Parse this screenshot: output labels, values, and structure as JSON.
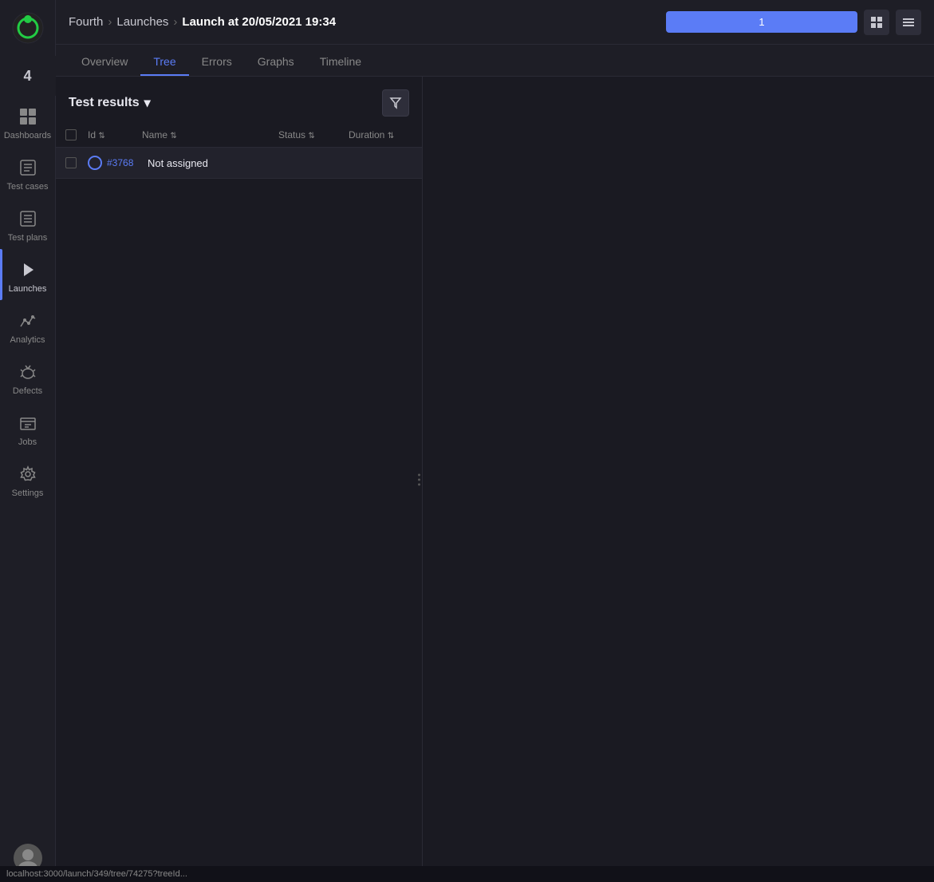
{
  "app": {
    "logo_alt": "App logo"
  },
  "sidebar": {
    "badge": "4",
    "items": [
      {
        "id": "dashboards",
        "label": "Dashboards",
        "active": false
      },
      {
        "id": "test-cases",
        "label": "Test cases",
        "active": false
      },
      {
        "id": "test-plans",
        "label": "Test plans",
        "active": false
      },
      {
        "id": "launches",
        "label": "Launches",
        "active": true
      },
      {
        "id": "analytics",
        "label": "Analytics",
        "active": false
      },
      {
        "id": "defects",
        "label": "Defects",
        "active": false
      },
      {
        "id": "jobs",
        "label": "Jobs",
        "active": false
      },
      {
        "id": "settings",
        "label": "Settings",
        "active": false
      }
    ]
  },
  "header": {
    "breadcrumb": {
      "project": "Fourth",
      "section": "Launches",
      "page": "Launch at 20/05/2021 19:34"
    },
    "search_value": "1",
    "search_placeholder": "1",
    "btn_grid_label": "Grid view",
    "btn_menu_label": "Menu"
  },
  "tabs": [
    {
      "id": "overview",
      "label": "Overview"
    },
    {
      "id": "tree",
      "label": "Tree",
      "active": true
    },
    {
      "id": "errors",
      "label": "Errors"
    },
    {
      "id": "graphs",
      "label": "Graphs"
    },
    {
      "id": "timeline",
      "label": "Timeline"
    }
  ],
  "panel": {
    "title": "Test results",
    "chevron": "▾",
    "filter_icon": "filter",
    "table": {
      "columns": [
        {
          "id": "id",
          "label": "Id",
          "sort": true
        },
        {
          "id": "name",
          "label": "Name",
          "sort": true
        },
        {
          "id": "status",
          "label": "Status",
          "sort": true
        },
        {
          "id": "duration",
          "label": "Duration",
          "sort": true
        }
      ],
      "rows": [
        {
          "id": "#3768",
          "name": "Not assigned",
          "status": "in-progress",
          "duration": ""
        }
      ]
    }
  },
  "statusbar": {
    "url": "localhost:3000/launch/349/tree/74275?treeId..."
  }
}
